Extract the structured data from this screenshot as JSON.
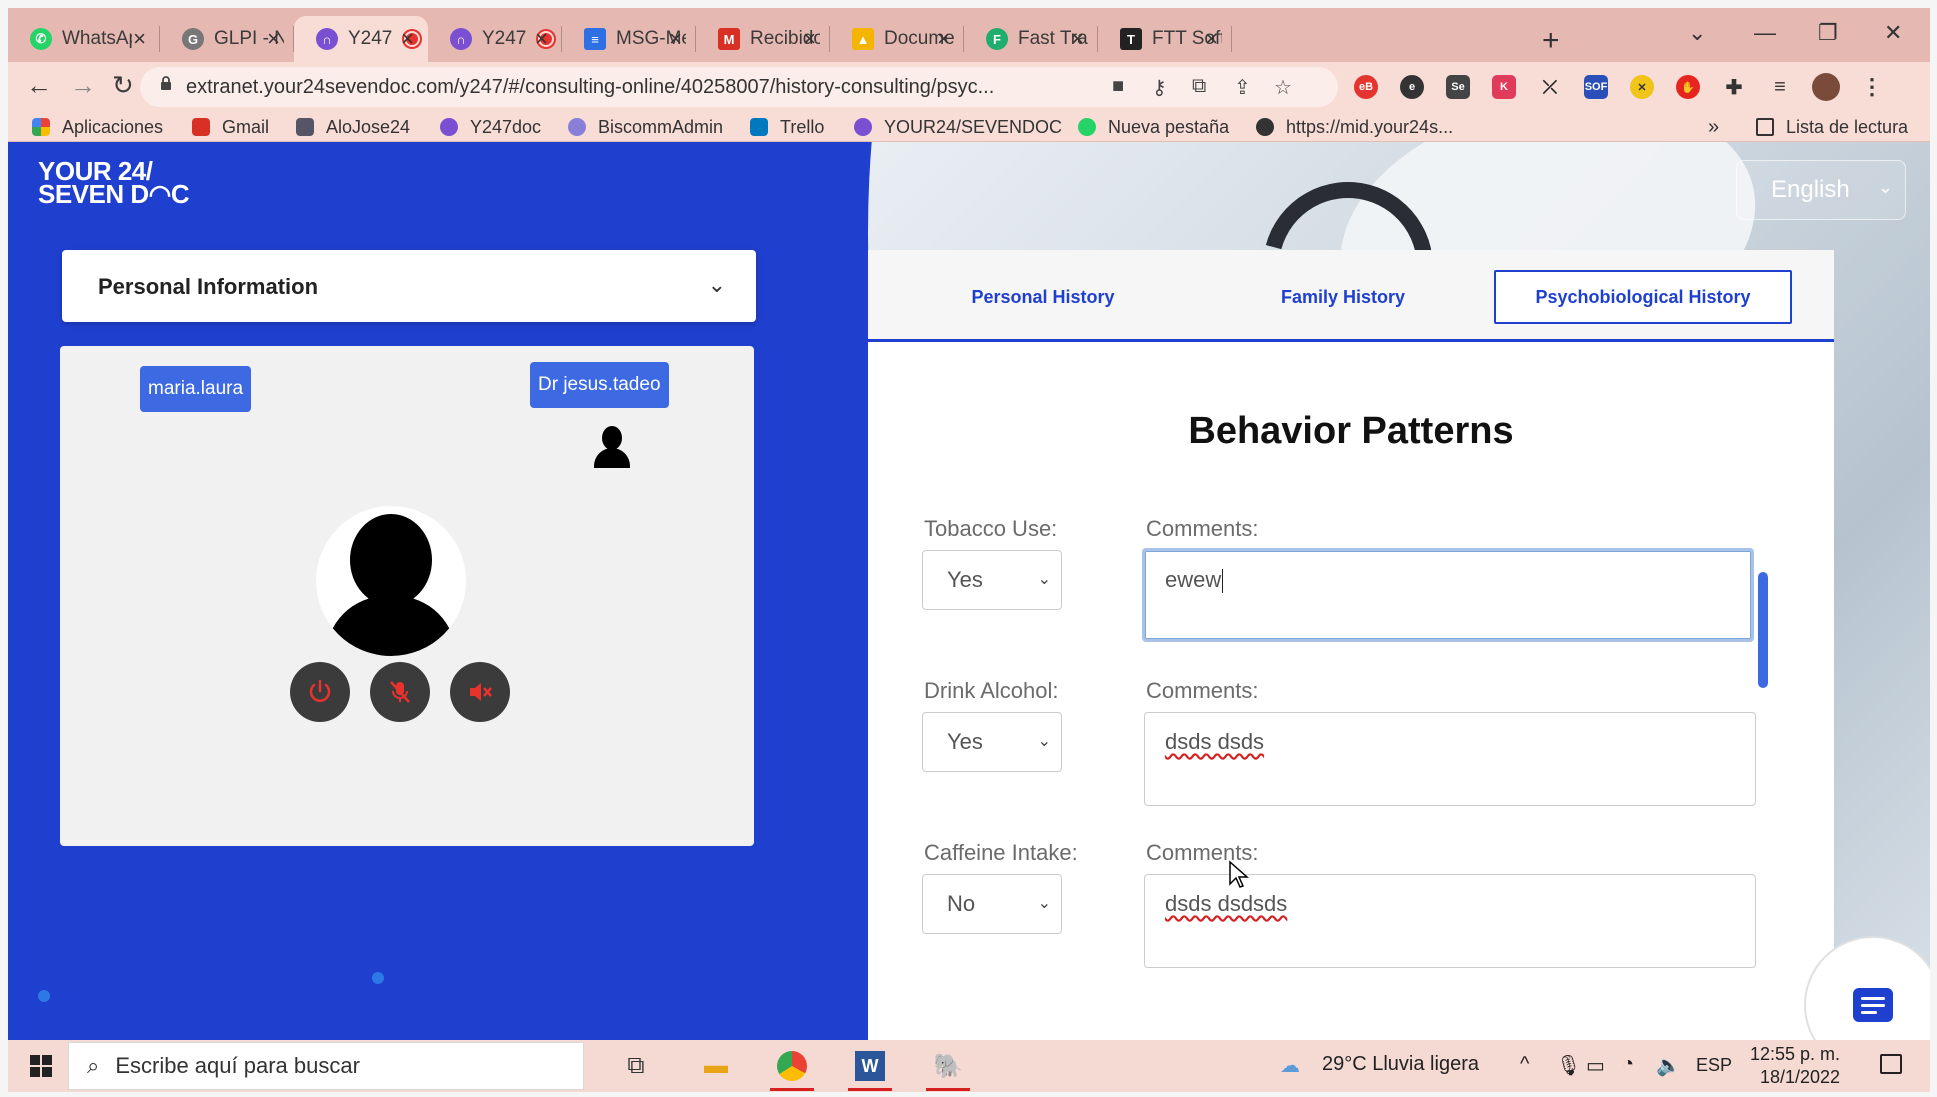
{
  "browser": {
    "tabs": [
      {
        "title": "WhatsAp",
        "icon": "whatsapp-icon",
        "color": "#25d366"
      },
      {
        "title": "GLPI - N",
        "icon": "glpi-icon",
        "color": "#555555"
      },
      {
        "title": "Y247",
        "icon": "y247-icon",
        "color": "#7b4fd1",
        "active": true
      },
      {
        "title": "Y247",
        "icon": "y247-icon",
        "color": "#7b4fd1"
      },
      {
        "title": "MSG-Me",
        "icon": "docs-icon",
        "color": "#2f6fe4"
      },
      {
        "title": "Recibido",
        "icon": "gmail-icon",
        "color": "#d93025"
      },
      {
        "title": "Documen",
        "icon": "drive-icon",
        "color": "#f4b400"
      },
      {
        "title": "Fast Trac",
        "icon": "fasttrack-icon",
        "color": "#1fae6d"
      },
      {
        "title": "FTT Softw",
        "icon": "ftt-icon",
        "color": "#222222"
      }
    ],
    "url": "extranet.your24sevendoc.com/y247/#/consulting-online/40258007/history-consulting/psyc...",
    "bookmarks": [
      {
        "label": "Aplicaciones",
        "icon": "apps-grid-icon"
      },
      {
        "label": "Gmail",
        "icon": "gmail-icon"
      },
      {
        "label": "AloJose24",
        "icon": "bookmark-icon"
      },
      {
        "label": "Y247doc",
        "icon": "y247-icon"
      },
      {
        "label": "BiscommAdmin",
        "icon": "biscomm-icon"
      },
      {
        "label": "Trello",
        "icon": "trello-icon"
      },
      {
        "label": "YOUR24/SEVENDOC",
        "icon": "y247-icon"
      },
      {
        "label": "Nueva pestaña",
        "icon": "whatsapp-icon"
      },
      {
        "label": "https://mid.your24s...",
        "icon": "globe-icon"
      }
    ],
    "reading_list": "Lista de lectura"
  },
  "app": {
    "logo_line1": "YOUR 24/",
    "logo_line2": "SEVEN D◠C",
    "language": "English",
    "personal_info_label": "Personal Information",
    "video": {
      "patient_tag": "maria.laura",
      "doctor_tag": "Dr jesus.tadeo"
    },
    "history_tabs": [
      {
        "label": "Personal History",
        "active": false
      },
      {
        "label": "Family History",
        "active": false
      },
      {
        "label": "Psychobiological History",
        "active": true
      }
    ],
    "section_title": "Behavior Patterns",
    "fields": [
      {
        "label": "Tobacco Use:",
        "value": "Yes",
        "comments_label": "Comments:",
        "comment": "ewew"
      },
      {
        "label": "Drink Alcohol:",
        "value": "Yes",
        "comments_label": "Comments:",
        "comment": "dsds dsds"
      },
      {
        "label": "Caffeine Intake:",
        "value": "No",
        "comments_label": "Comments:",
        "comment": "dsds dsdsds"
      }
    ]
  },
  "taskbar": {
    "search_placeholder": "Escribe aquí para buscar",
    "weather": "29°C  Lluvia ligera",
    "lang": "ESP",
    "time": "12:55 p. m.",
    "date": "18/1/2022"
  },
  "colors": {
    "brand_blue": "#1f3fcf",
    "tag_blue": "#3d6ae2",
    "tab_strip": "#e6b8b2"
  }
}
